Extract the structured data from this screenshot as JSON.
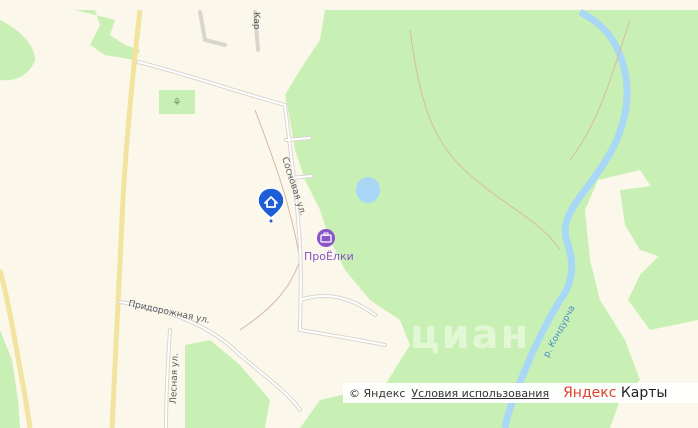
{
  "map": {
    "streets": {
      "sosnovaya": "Сосновая ул.",
      "pridorozhnaya": "Придорожная ул.",
      "lesnaya": "Лесная ул.",
      "kar": "Кар"
    },
    "river": "р. Кондурча",
    "poi": {
      "name": "ПроЁлки",
      "icon": "briefcase-icon"
    },
    "marker": {
      "icon": "house-pin-icon"
    },
    "watermark": "циан",
    "colors": {
      "forest": "#c9f0b4",
      "land": "#fbf7ea",
      "river": "#a8d8f5",
      "road": "#e8e2c0",
      "poi": "#8a54c9",
      "marker": "#1e5fd6"
    }
  },
  "attribution": {
    "copyright": "© Яндекс",
    "terms": "Условия использования",
    "logo_part1": "Яндекс",
    "logo_part2": "Карты"
  }
}
